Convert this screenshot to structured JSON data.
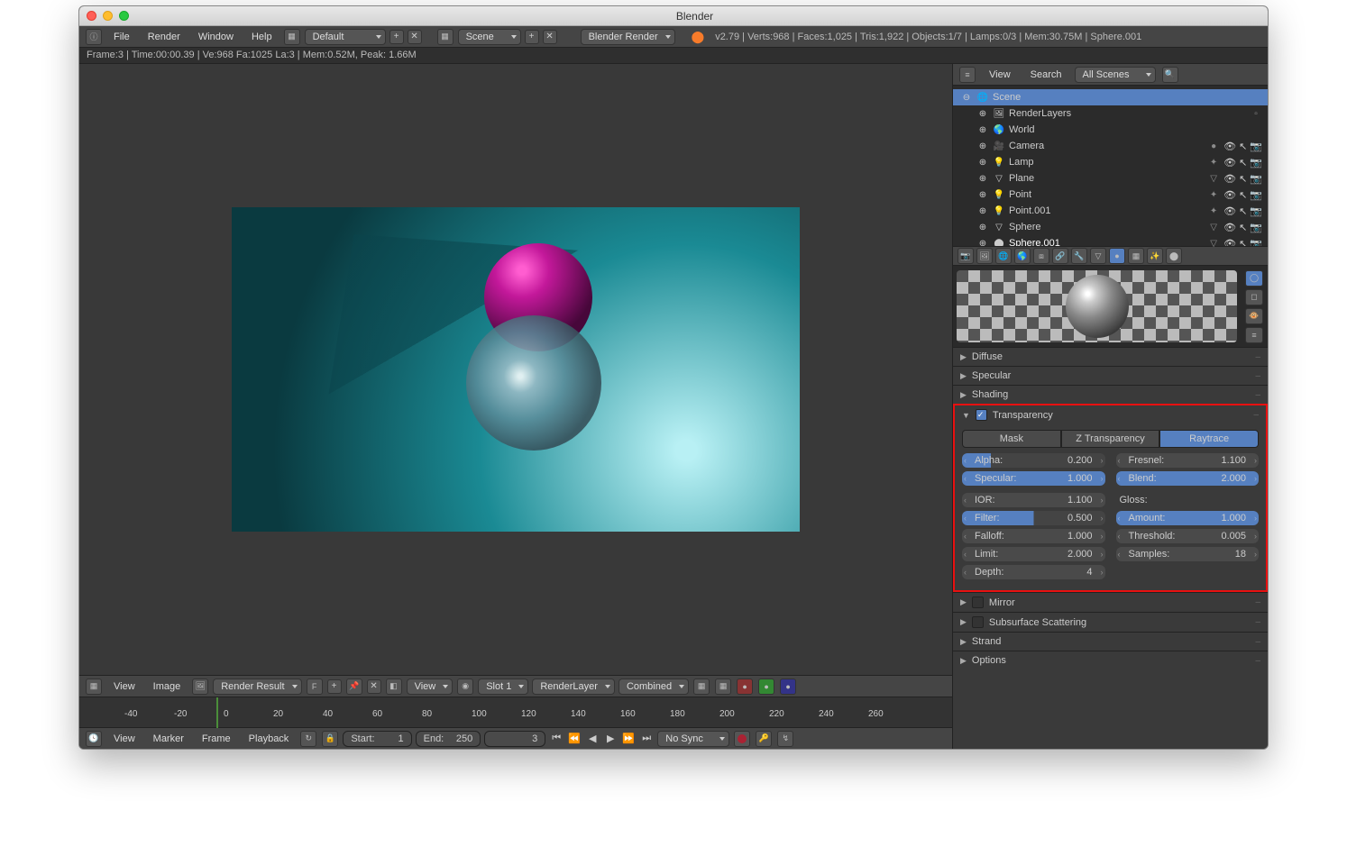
{
  "window": {
    "title": "Blender"
  },
  "topmenu": {
    "file": "File",
    "render": "Render",
    "window": "Window",
    "help": "Help"
  },
  "top": {
    "layout": "Default",
    "scene": "Scene",
    "engine": "Blender Render",
    "stats": "v2.79 | Verts:968 | Faces:1,025 | Tris:1,922 | Objects:1/7 | Lamps:0/3 | Mem:30.75M | Sphere.001"
  },
  "status": "Frame:3 | Time:00:00.39 | Ve:968 Fa:1025 La:3 | Mem:0.52M, Peak: 1.66M",
  "image_bar": {
    "view": "View",
    "image": "Image",
    "result": "Render Result",
    "f": "F",
    "view2": "View",
    "slot": "Slot 1",
    "renderlayer": "RenderLayer",
    "pass": "Combined"
  },
  "timeline_ticks": [
    "-40",
    "-20",
    "0",
    "20",
    "40",
    "60",
    "80",
    "100",
    "120",
    "140",
    "160",
    "180",
    "200",
    "220",
    "240",
    "260"
  ],
  "timeline": {
    "view": "View",
    "marker": "Marker",
    "frame": "Frame",
    "playback": "Playback",
    "start_lbl": "Start:",
    "start": "1",
    "end_lbl": "End:",
    "end": "250",
    "current": "3",
    "sync": "No Sync"
  },
  "outliner": {
    "view": "View",
    "search": "Search",
    "filter": "All Scenes",
    "items": [
      {
        "indent": 0,
        "icon": "🌐",
        "name": "Scene",
        "sel": true,
        "row": false
      },
      {
        "indent": 1,
        "icon": "🖼",
        "name": "RenderLayers",
        "row": false,
        "extra": "ic"
      },
      {
        "indent": 1,
        "icon": "🌎",
        "name": "World",
        "row": false
      },
      {
        "indent": 1,
        "icon": "🎥",
        "name": "Camera",
        "row": true,
        "extra": "mat"
      },
      {
        "indent": 1,
        "icon": "💡",
        "name": "Lamp",
        "row": true,
        "extra": "dot"
      },
      {
        "indent": 1,
        "icon": "▽",
        "name": "Plane",
        "row": true,
        "extra": "tri"
      },
      {
        "indent": 1,
        "icon": "💡",
        "name": "Point",
        "row": true,
        "extra": "dot"
      },
      {
        "indent": 1,
        "icon": "💡",
        "name": "Point.001",
        "row": true,
        "extra": "dot"
      },
      {
        "indent": 1,
        "icon": "▽",
        "name": "Sphere",
        "row": true,
        "extra": "tri"
      },
      {
        "indent": 1,
        "icon": "⬤",
        "name": "Sphere.001",
        "row": true,
        "extra": "tri",
        "active": true
      }
    ]
  },
  "panels": {
    "diffuse": "Diffuse",
    "specular": "Specular",
    "shading": "Shading",
    "transparency": "Transparency",
    "mirror": "Mirror",
    "sss": "Subsurface Scattering",
    "strand": "Strand",
    "options": "Options"
  },
  "transparency": {
    "modes": {
      "mask": "Mask",
      "z": "Z Transparency",
      "ray": "Raytrace"
    },
    "alpha_lbl": "Alpha:",
    "alpha": "0.200",
    "specular_lbl": "Specular:",
    "specular": "1.000",
    "fresnel_lbl": "Fresnel:",
    "fresnel": "1.100",
    "blend_lbl": "Blend:",
    "blend": "2.000",
    "ior_lbl": "IOR:",
    "ior": "1.100",
    "filter_lbl": "Filter:",
    "filter": "0.500",
    "falloff_lbl": "Falloff:",
    "falloff": "1.000",
    "limit_lbl": "Limit:",
    "limit": "2.000",
    "depth_lbl": "Depth:",
    "depth": "4",
    "gloss_hdr": "Gloss:",
    "amount_lbl": "Amount:",
    "amount": "1.000",
    "threshold_lbl": "Threshold:",
    "threshold": "0.005",
    "samples_lbl": "Samples:",
    "samples": "18"
  }
}
